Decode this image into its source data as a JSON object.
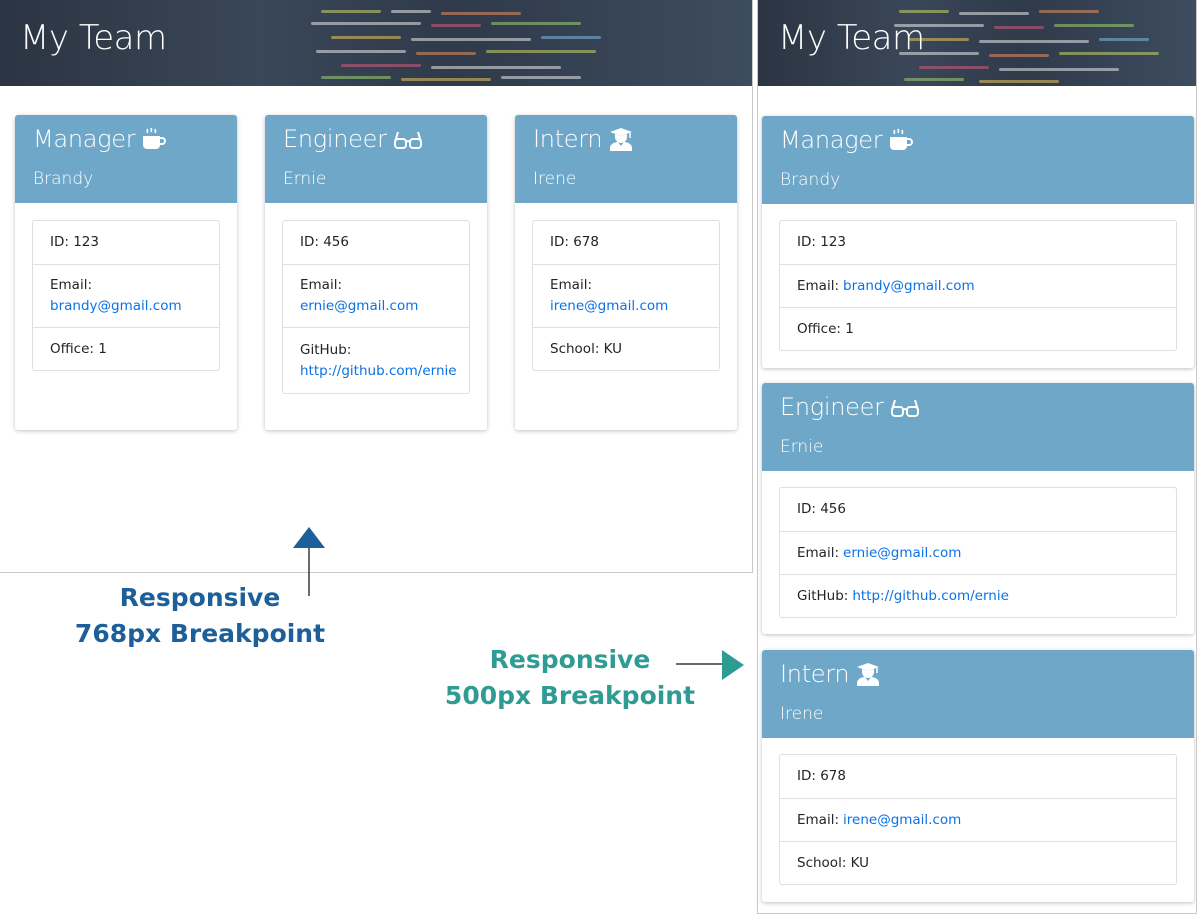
{
  "page_title": "My Team",
  "colors": {
    "card_header": "#6fa7c8",
    "link": "#0b72e6",
    "note_768": "#1d5f98",
    "note_500": "#2f9c94"
  },
  "members": [
    {
      "role": "Manager",
      "icon": "coffee-mug-icon",
      "name": "Brandy",
      "id_label": "ID: 123",
      "email_label": "Email:",
      "email": "brandy@gmail.com",
      "extra_label": "Office: 1",
      "extra_link": ""
    },
    {
      "role": "Engineer",
      "icon": "glasses-icon",
      "name": "Ernie",
      "id_label": "ID: 456",
      "email_label": "Email:",
      "email": "ernie@gmail.com",
      "extra_label": "GitHub:",
      "extra_link": "http://github.com/ernie"
    },
    {
      "role": "Intern",
      "icon": "graduate-icon",
      "name": "Irene",
      "id_label": "ID: 678",
      "email_label": "Email:",
      "email": "irene@gmail.com",
      "extra_label": "School: KU",
      "extra_link": ""
    }
  ],
  "annotations": {
    "breakpoint_768": {
      "line1": "Responsive",
      "line2": "768px Breakpoint"
    },
    "breakpoint_500": {
      "line1": "Responsive",
      "line2": "500px Breakpoint"
    }
  }
}
